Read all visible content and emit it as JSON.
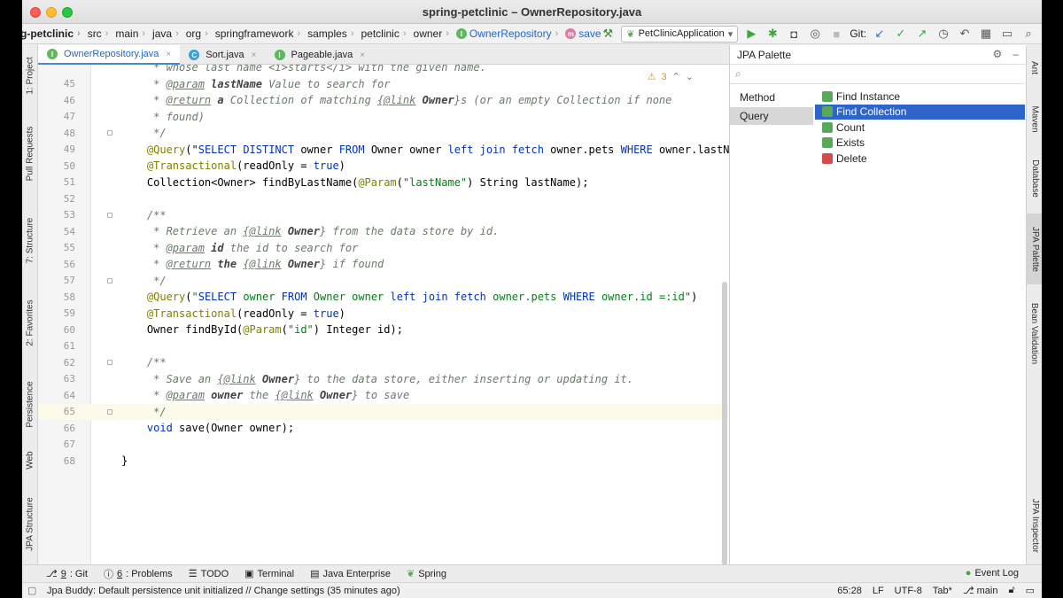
{
  "window": {
    "title": "spring-petclinic – OwnerRepository.java"
  },
  "breadcrumb": [
    "g-petclinic",
    "src",
    "main",
    "java",
    "org",
    "springframework",
    "samples",
    "petclinic",
    "owner",
    "OwnerRepository",
    "save"
  ],
  "toolbar": {
    "run_config": "PetClinicApplication",
    "git_label": "Git:"
  },
  "tabs": [
    {
      "label": "OwnerRepository.java",
      "icon": "interface-icon",
      "active": true
    },
    {
      "label": "Sort.java",
      "icon": "class-icon",
      "active": false
    },
    {
      "label": "Pageable.java",
      "icon": "interface-icon",
      "active": false
    }
  ],
  "left_tools": [
    "1: Project",
    "Pull Requests",
    "7: Structure",
    "2: Favorites",
    "Persistence",
    "Web",
    "JPA Structure"
  ],
  "right_tools": [
    "Ant",
    "Maven",
    "Database",
    "JPA Palette",
    "Bean Validation",
    "JPA Inspector"
  ],
  "editor": {
    "warnings": "3",
    "current_line": "65",
    "lines": [
      {
        "n": "45",
        "text": "     * @param lastName Value to search for"
      },
      {
        "n": "46",
        "text": "     * @return a Collection of matching {@link Owner}s (or an empty Collection if none"
      },
      {
        "n": "47",
        "text": "     * found)"
      },
      {
        "n": "48",
        "text": "     */"
      },
      {
        "n": "49",
        "text": "    @Query(\"SELECT DISTINCT owner FROM Owner owner left join fetch owner.pets WHERE owner.lastName LIK"
      },
      {
        "n": "50",
        "text": "    @Transactional(readOnly = true)"
      },
      {
        "n": "51",
        "text": "    Collection<Owner> findByLastName(@Param(\"lastName\") String lastName);"
      },
      {
        "n": "52",
        "text": ""
      },
      {
        "n": "53",
        "text": "    /**"
      },
      {
        "n": "54",
        "text": "     * Retrieve an {@link Owner} from the data store by id."
      },
      {
        "n": "55",
        "text": "     * @param id the id to search for"
      },
      {
        "n": "56",
        "text": "     * @return the {@link Owner} if found"
      },
      {
        "n": "57",
        "text": "     */"
      },
      {
        "n": "58",
        "text": "    @Query(\"SELECT owner FROM Owner owner left join fetch owner.pets WHERE owner.id =:id\")"
      },
      {
        "n": "59",
        "text": "    @Transactional(readOnly = true)"
      },
      {
        "n": "60",
        "text": "    Owner findById(@Param(\"id\") Integer id);"
      },
      {
        "n": "61",
        "text": ""
      },
      {
        "n": "62",
        "text": "    /**"
      },
      {
        "n": "63",
        "text": "     * Save an {@link Owner} to the data store, either inserting or updating it."
      },
      {
        "n": "64",
        "text": "     * @param owner the {@link Owner} to save"
      },
      {
        "n": "65",
        "text": "     */"
      },
      {
        "n": "66",
        "text": "    void save(Owner owner);"
      },
      {
        "n": "67",
        "text": ""
      },
      {
        "n": "68",
        "text": "}"
      }
    ],
    "top_partial": "     * whose last name <i>starts</i> with the given name."
  },
  "palette": {
    "title": "JPA Palette",
    "categories": [
      "Method",
      "Query"
    ],
    "selected_category": "Query",
    "items": [
      "Find Instance",
      "Find Collection",
      "Count",
      "Exists",
      "Delete"
    ],
    "selected_item": "Find Collection"
  },
  "bottom_tools": [
    {
      "num": "9",
      "label": ": Git"
    },
    {
      "num": "6",
      "label": ": Problems"
    },
    {
      "num": "",
      "label": "TODO"
    },
    {
      "num": "",
      "label": "Terminal"
    },
    {
      "num": "",
      "label": "Java Enterprise"
    },
    {
      "num": "",
      "label": "Spring"
    }
  ],
  "event_log": "Event Log",
  "status": {
    "message": "Jpa Buddy: Default persistence unit initialized // Change settings (35 minutes ago)",
    "position": "65:28",
    "line_sep": "LF",
    "encoding": "UTF-8",
    "indent": "Tab*",
    "branch": "main"
  }
}
